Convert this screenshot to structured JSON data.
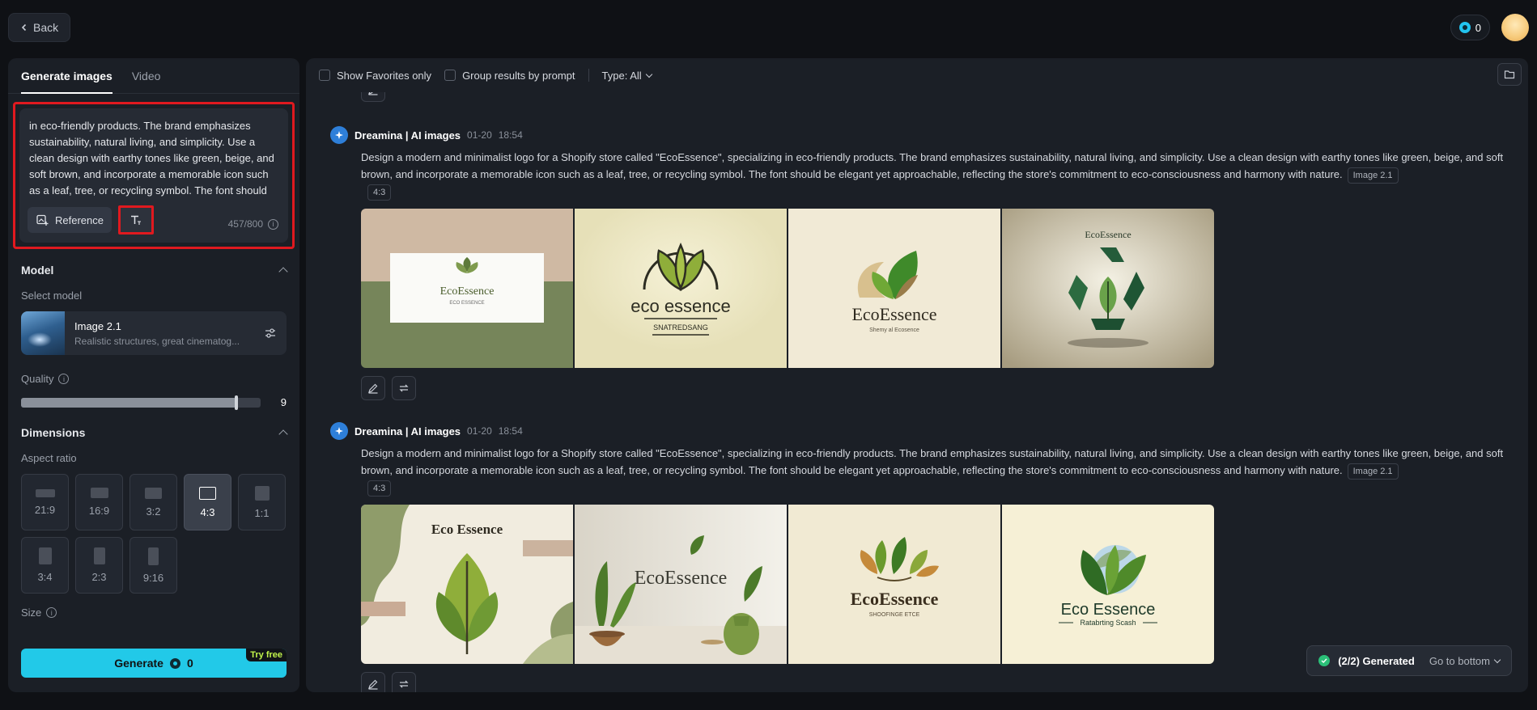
{
  "topbar": {
    "back_label": "Back",
    "credits": "0"
  },
  "left": {
    "tabs": [
      {
        "label": "Generate images",
        "active": true
      },
      {
        "label": "Video",
        "active": false
      }
    ],
    "prompt": {
      "text": "in eco-friendly products. The brand emphasizes sustainability, natural living, and simplicity. Use a clean design with earthy tones like green, beige, and soft brown, and incorporate a memorable icon such as a leaf, tree, or recycling symbol. The font should be elegant yet approachable",
      "reference_label": "Reference",
      "counter": "457/800"
    },
    "model": {
      "section_title": "Model",
      "select_label": "Select model",
      "name": "Image 2.1",
      "description": "Realistic structures, great cinematog..."
    },
    "quality": {
      "label": "Quality",
      "value": "9",
      "fraction": 0.9
    },
    "dimensions": {
      "section_title": "Dimensions",
      "aspect_label": "Aspect ratio",
      "ratios": [
        {
          "label": "21:9",
          "active": false
        },
        {
          "label": "16:9",
          "active": false
        },
        {
          "label": "3:2",
          "active": false
        },
        {
          "label": "4:3",
          "active": true
        },
        {
          "label": "1:1",
          "active": false
        },
        {
          "label": "3:4",
          "active": false
        },
        {
          "label": "2:3",
          "active": false
        },
        {
          "label": "9:16",
          "active": false
        }
      ],
      "size_label": "Size"
    },
    "generate": {
      "label": "Generate",
      "cost": "0",
      "badge": "Try free"
    }
  },
  "right": {
    "toolbar": {
      "favorites_label": "Show Favorites only",
      "group_label": "Group results by prompt",
      "type_label": "Type: All"
    },
    "results": [
      {
        "author": "Dreamina | AI images",
        "date": "01-20",
        "time": "18:54",
        "prompt": "Design a modern and minimalist logo for a Shopify store called \"EcoEssence\", specializing in eco-friendly products. The brand emphasizes sustainability, natural living, and simplicity. Use a clean design with earthy tones like green, beige, and soft brown, and incorporate a memorable icon such as a leaf, tree, or recycling symbol. The font should be elegant yet approachable, reflecting the store's commitment to eco-consciousness and harmony with nature.",
        "model_tag": "Image 2.1",
        "ratio_tag": "4:3",
        "images": [
          {
            "title": "EcoEssence",
            "subtitle": "ECO ESSENCE"
          },
          {
            "title": "eco essence",
            "subtitle": "SNATREDSANG"
          },
          {
            "title": "EcoEssence",
            "subtitle": "Shemy al Ecosence"
          },
          {
            "title": "EcoEssence",
            "subtitle": ""
          }
        ]
      },
      {
        "author": "Dreamina | AI images",
        "date": "01-20",
        "time": "18:54",
        "prompt": "Design a modern and minimalist logo for a Shopify store called \"EcoEssence\", specializing in eco-friendly products. The brand emphasizes sustainability, natural living, and simplicity. Use a clean design with earthy tones like green, beige, and soft brown, and incorporate a memorable icon such as a leaf, tree, or recycling symbol. The font should be elegant yet approachable, reflecting the store's commitment to eco-consciousness and harmony with nature.",
        "model_tag": "Image 2.1",
        "ratio_tag": "4:3",
        "images": [
          {
            "title": "Eco Essence",
            "subtitle": ""
          },
          {
            "title": "EcoEssence",
            "subtitle": ""
          },
          {
            "title": "EcoEssence",
            "subtitle": "SHOOFINGE ETCE"
          },
          {
            "title": "Eco Essence",
            "subtitle": "Ratabrting Scash"
          }
        ]
      }
    ],
    "toast": {
      "status": "(2/2) Generated",
      "link": "Go to bottom"
    }
  },
  "colors": {
    "accent": "#22c9e8",
    "highlight": "#e0191f",
    "success": "#2bbf78"
  }
}
